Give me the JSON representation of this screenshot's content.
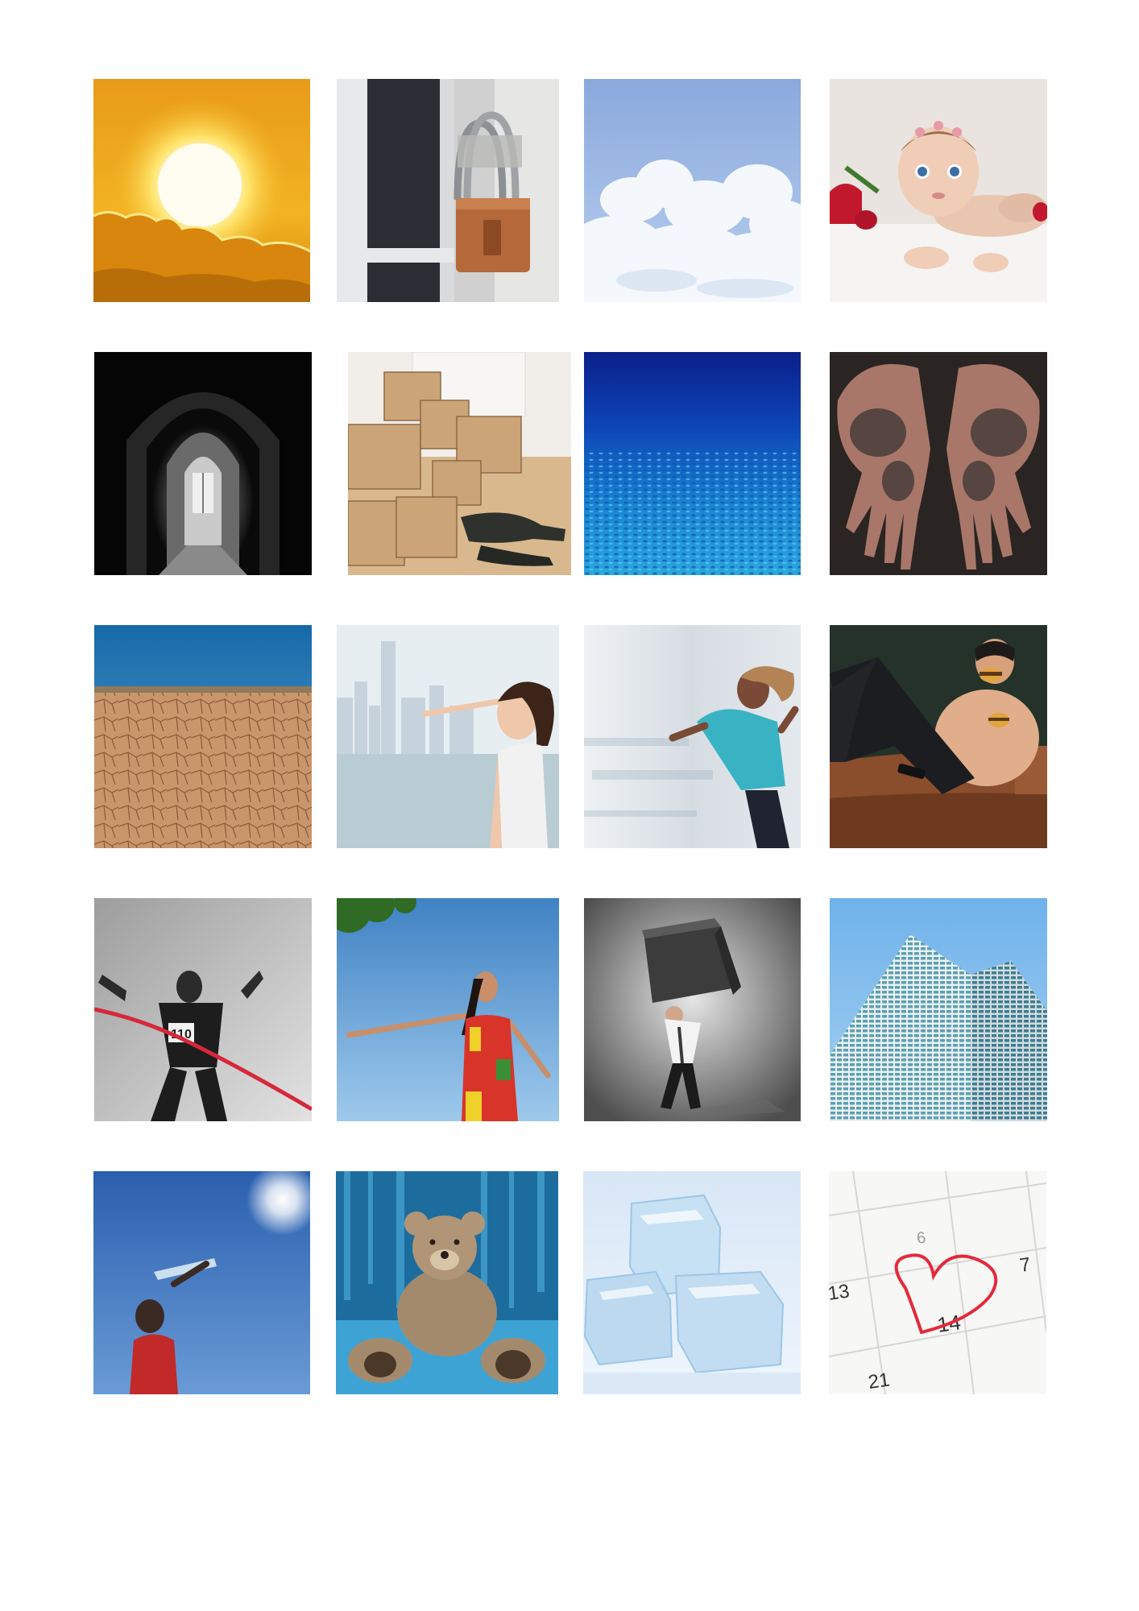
{
  "sheet": {
    "background": "#ffffff",
    "tiles": [
      {
        "name": "sun-photo",
        "row": 1,
        "col": 1
      },
      {
        "name": "padlock-photo",
        "row": 1,
        "col": 2
      },
      {
        "name": "clouds-photo",
        "row": 1,
        "col": 3
      },
      {
        "name": "baby-photo",
        "row": 1,
        "col": 4
      },
      {
        "name": "gothic-corridor-photo",
        "row": 2,
        "col": 1
      },
      {
        "name": "moving-boxes-photo",
        "row": 2,
        "col": 2
      },
      {
        "name": "deep-sea-photo",
        "row": 2,
        "col": 3
      },
      {
        "name": "dirty-hands-photo",
        "row": 2,
        "col": 4
      },
      {
        "name": "dry-cracked-earth-photo",
        "row": 3,
        "col": 1
      },
      {
        "name": "woman-pointing-at-city-photo",
        "row": 3,
        "col": 2
      },
      {
        "name": "running-woman-photo",
        "row": 3,
        "col": 3
      },
      {
        "name": "man-eating-burger-photo",
        "row": 3,
        "col": 4
      },
      {
        "name": "runner-finish-line-photo",
        "row": 4,
        "col": 1
      },
      {
        "name": "woman-arms-open-photo",
        "row": 4,
        "col": 2
      },
      {
        "name": "man-carrying-cube-photo",
        "row": 4,
        "col": 3
      },
      {
        "name": "skyscraper-photo",
        "row": 4,
        "col": 4
      },
      {
        "name": "child-drinking-water-photo",
        "row": 5,
        "col": 1
      },
      {
        "name": "teddy-bear-photo",
        "row": 5,
        "col": 2
      },
      {
        "name": "ice-cubes-photo",
        "row": 5,
        "col": 3
      },
      {
        "name": "calendar-heart-photo",
        "row": 5,
        "col": 4
      }
    ]
  },
  "runner_bib": "110",
  "calendar": {
    "day_6": "6",
    "day_7": "7",
    "day_13": "13",
    "day_14": "14",
    "day_21": "21"
  }
}
